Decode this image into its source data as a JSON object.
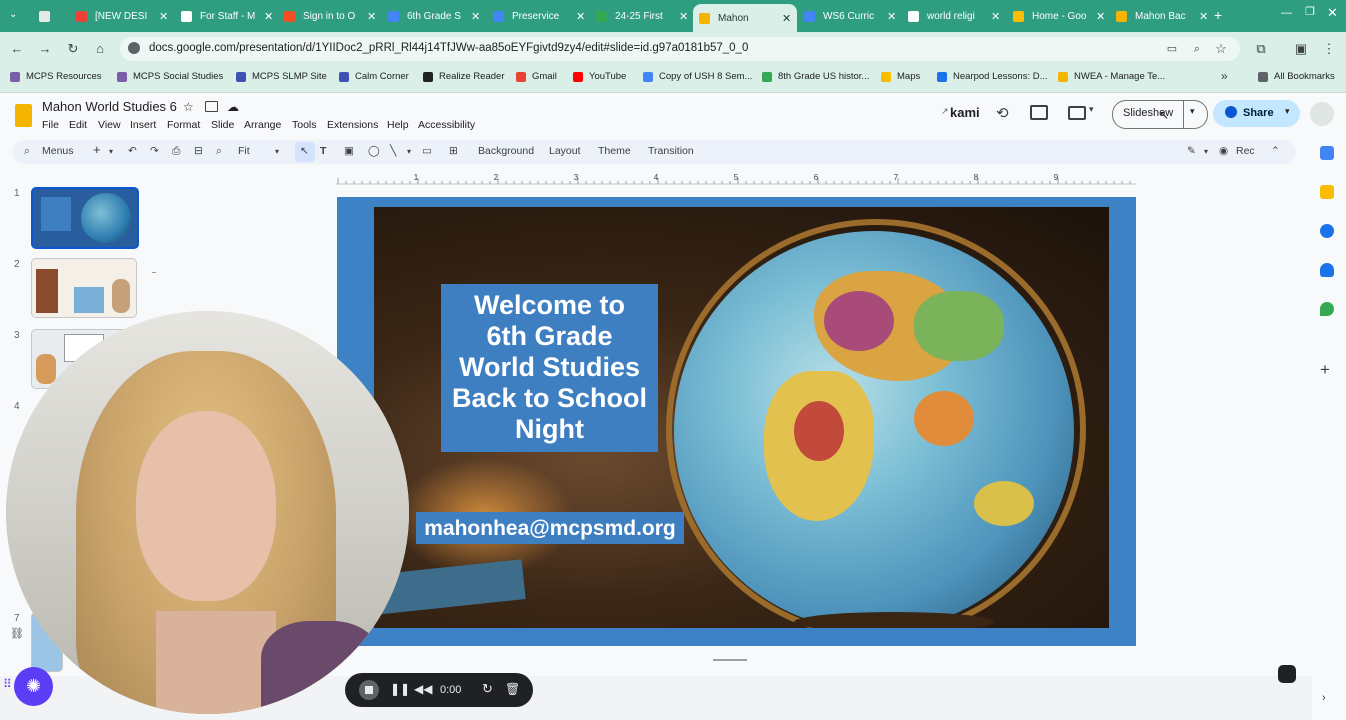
{
  "tabs": [
    {
      "label": "",
      "color": "#e8e8e8"
    },
    {
      "label": "[NEW DESI",
      "color": "#ea4335"
    },
    {
      "label": "For Staff - M",
      "color": "#ffffff"
    },
    {
      "label": "Sign in to O",
      "color": "#f25022"
    },
    {
      "label": "6th Grade S",
      "color": "#4285f4"
    },
    {
      "label": "Preservice",
      "color": "#4285f4"
    },
    {
      "label": "24-25 First",
      "color": "#34a853"
    },
    {
      "label": "Mahon",
      "color": "#f4b400"
    },
    {
      "label": "WS6 Curric",
      "color": "#4285f4"
    },
    {
      "label": "world religi",
      "color": "#ffffff"
    },
    {
      "label": "Home - Goo",
      "color": "#fbbc04"
    },
    {
      "label": "Mahon Bac",
      "color": "#f4b400"
    }
  ],
  "address": {
    "url": "docs.google.com/presentation/d/1YIIDoc2_pRRl_Rl44j14TfJWw-aa85oEYFgivtd9zy4/edit#slide=id.g97a0181b57_0_0"
  },
  "bookmarks": [
    {
      "label": "MCPS Resources",
      "color": "#7a5ea8"
    },
    {
      "label": "MCPS Social Studies",
      "color": "#7a5ea8"
    },
    {
      "label": "MCPS SLMP Site",
      "color": "#3f51b5"
    },
    {
      "label": "Calm Corner",
      "color": "#3f51b5"
    },
    {
      "label": "Realize Reader",
      "color": "#202124"
    },
    {
      "label": "Gmail",
      "color": "#ea4335"
    },
    {
      "label": "YouTube",
      "color": "#ff0000"
    },
    {
      "label": "Copy of USH 8 Sem...",
      "color": "#4285f4"
    },
    {
      "label": "8th Grade US histor...",
      "color": "#34a853"
    },
    {
      "label": "Maps",
      "color": "#fbbc04"
    },
    {
      "label": "Nearpod Lessons: D...",
      "color": "#1a73e8"
    },
    {
      "label": "NWEA - Manage Te...",
      "color": "#f4b400"
    },
    {
      "label": "All Bookmarks",
      "color": "#5f6368"
    }
  ],
  "app": {
    "title": "Mahon World Studies 6",
    "menus": [
      "File",
      "Edit",
      "View",
      "Insert",
      "Format",
      "Slide",
      "Arrange",
      "Tools",
      "Extensions",
      "Help",
      "Accessibility"
    ],
    "kami": "kami",
    "slideshow": "Slideshow",
    "share": "Share"
  },
  "toolbar": {
    "menus_search": "Menus",
    "zoom": "Fit",
    "background": "Background",
    "layout": "Layout",
    "theme": "Theme",
    "transition": "Transition",
    "rec": "Rec"
  },
  "ruler_ticks": [
    "1",
    "2",
    "3",
    "4",
    "5",
    "6",
    "7",
    "8",
    "9"
  ],
  "filmstrip": [
    "1",
    "2",
    "3",
    "4",
    "7"
  ],
  "slide": {
    "title": "Welcome to\n6th Grade\nWorld Studies\nBack to School\nNight",
    "email": "mahonhea@mcpsmd.org"
  },
  "recorder": {
    "time": "0:00"
  }
}
